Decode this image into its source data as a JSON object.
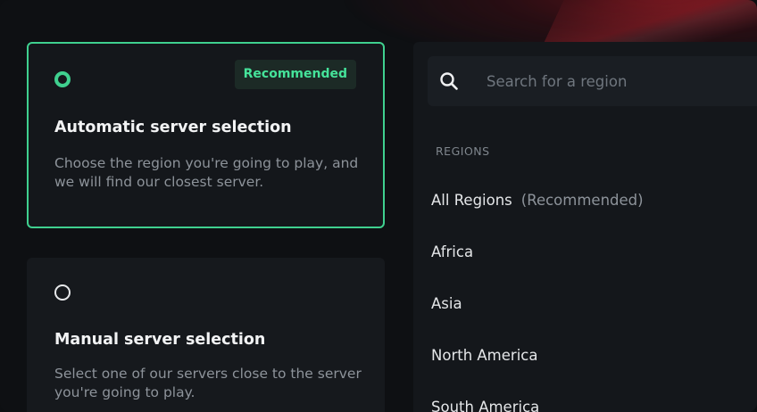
{
  "server_selection": {
    "automatic": {
      "badge": "Recommended",
      "title": "Automatic server selection",
      "description": "Choose the region you're going to play, and we will find our closest server.",
      "selected": true
    },
    "manual": {
      "title": "Manual server selection",
      "description": "Select one of our servers close to the server you're going to play.",
      "selected": false
    }
  },
  "regions_panel": {
    "search_placeholder": "Search for a region",
    "section_label": "REGIONS",
    "items": [
      {
        "label": "All Regions",
        "note": "(Recommended)"
      },
      {
        "label": "Africa",
        "note": ""
      },
      {
        "label": "Asia",
        "note": ""
      },
      {
        "label": "North America",
        "note": ""
      },
      {
        "label": "South America",
        "note": ""
      }
    ]
  },
  "colors": {
    "accent": "#3fd08f",
    "background": "#0e1013",
    "card": "#14171b"
  },
  "icons": {
    "search": "search-icon",
    "radio_selected": "radio-selected-icon",
    "radio_unselected": "radio-unselected-icon"
  }
}
